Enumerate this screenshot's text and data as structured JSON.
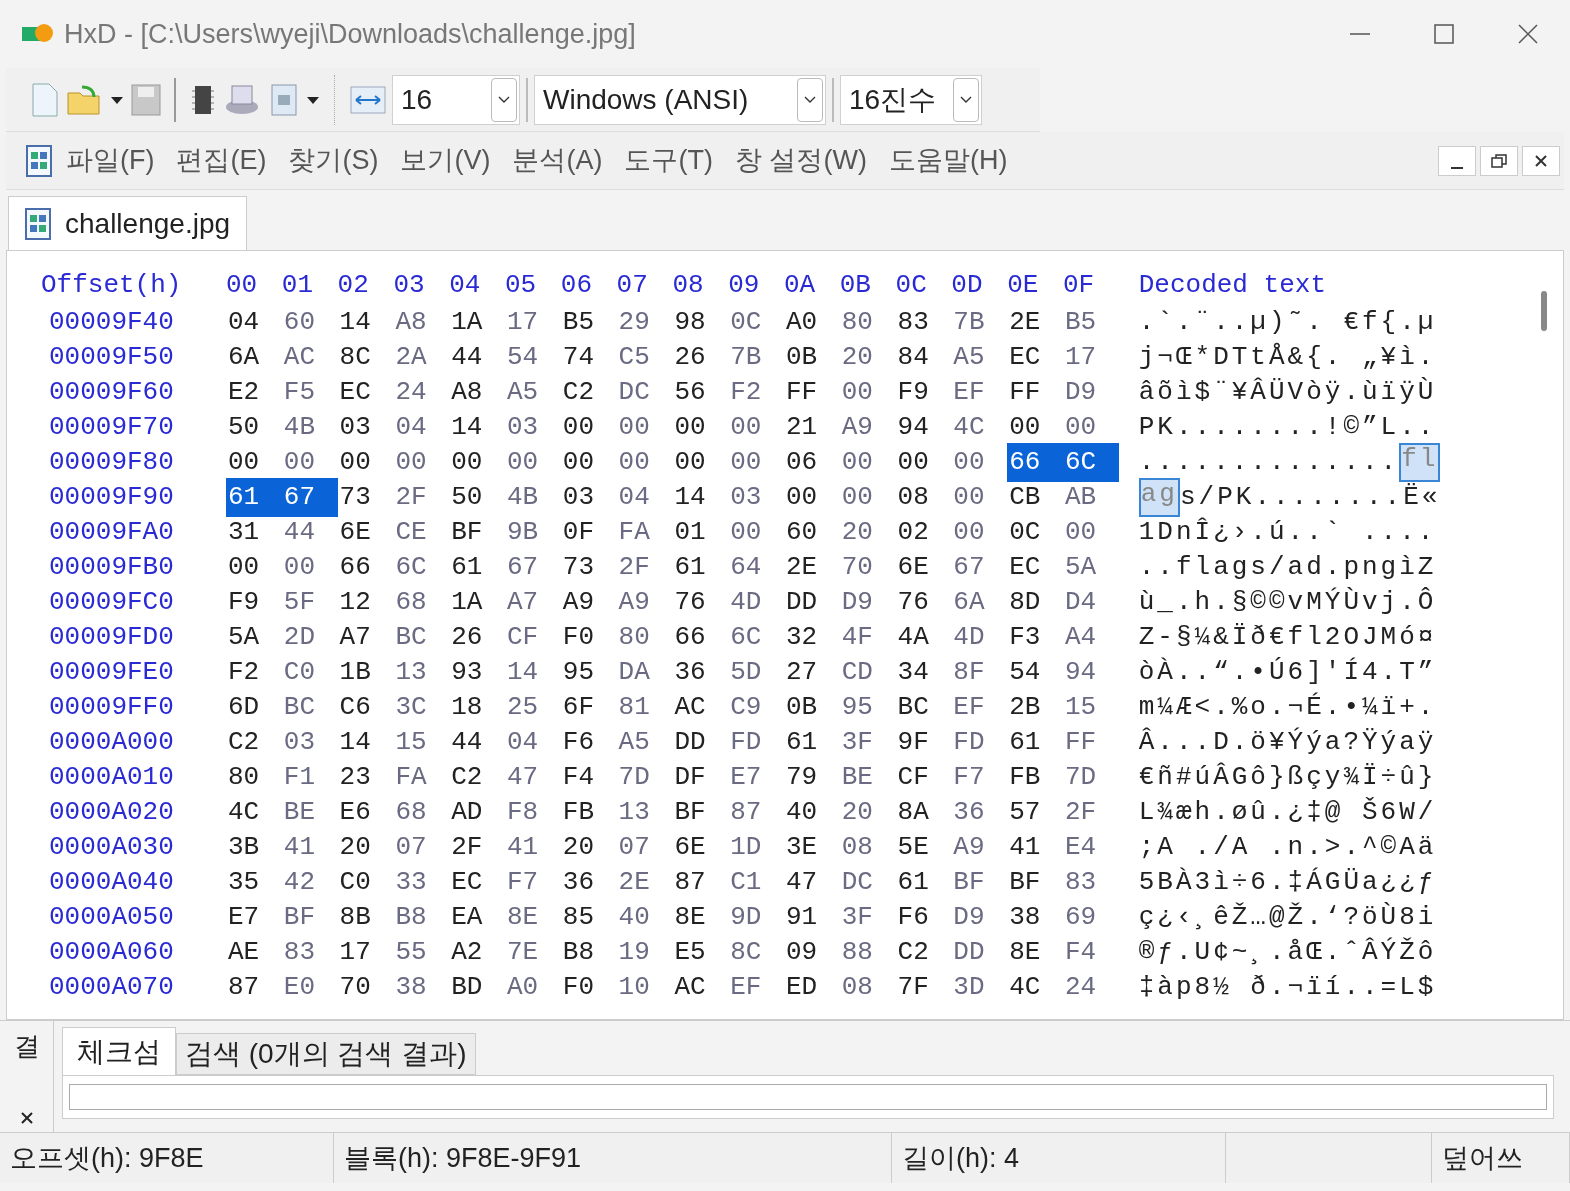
{
  "window": {
    "title": "HxD - [C:\\Users\\wyeji\\Downloads\\challenge.jpg]"
  },
  "toolbar": {
    "bytes_per_row": "16",
    "charset": "Windows (ANSI)",
    "base": "16진수"
  },
  "menu": [
    "파일(F)",
    "편집(E)",
    "찾기(S)",
    "보기(V)",
    "분석(A)",
    "도구(T)",
    "창 설정(W)",
    "도움말(H)"
  ],
  "document_tab": {
    "label": "challenge.jpg"
  },
  "hex": {
    "offset_header": "Offset(h)",
    "columns": [
      "00",
      "01",
      "02",
      "03",
      "04",
      "05",
      "06",
      "07",
      "08",
      "09",
      "0A",
      "0B",
      "0C",
      "0D",
      "0E",
      "0F"
    ],
    "decoded_header": "Decoded text",
    "rows": [
      {
        "offset": "00009F40",
        "bytes": [
          {
            "v": "04",
            "selected": false
          },
          {
            "v": "60",
            "selected": false
          },
          {
            "v": "14",
            "selected": false
          },
          {
            "v": "A8",
            "selected": false
          },
          {
            "v": "1A",
            "selected": false
          },
          {
            "v": "17",
            "selected": false
          },
          {
            "v": "B5",
            "selected": false
          },
          {
            "v": "29",
            "selected": false
          },
          {
            "v": "98",
            "selected": false
          },
          {
            "v": "0C",
            "selected": false
          },
          {
            "v": "A0",
            "selected": false
          },
          {
            "v": "80",
            "selected": false
          },
          {
            "v": "83",
            "selected": false
          },
          {
            "v": "7B",
            "selected": false
          },
          {
            "v": "2E",
            "selected": false
          },
          {
            "v": "B5",
            "selected": false
          }
        ],
        "decoded": [
          {
            "text": ".`.¨..µ)˜. €f{.µ",
            "selected": false
          }
        ]
      },
      {
        "offset": "00009F50",
        "bytes": [
          {
            "v": "6A",
            "selected": false
          },
          {
            "v": "AC",
            "selected": false
          },
          {
            "v": "8C",
            "selected": false
          },
          {
            "v": "2A",
            "selected": false
          },
          {
            "v": "44",
            "selected": false
          },
          {
            "v": "54",
            "selected": false
          },
          {
            "v": "74",
            "selected": false
          },
          {
            "v": "C5",
            "selected": false
          },
          {
            "v": "26",
            "selected": false
          },
          {
            "v": "7B",
            "selected": false
          },
          {
            "v": "0B",
            "selected": false
          },
          {
            "v": "20",
            "selected": false
          },
          {
            "v": "84",
            "selected": false
          },
          {
            "v": "A5",
            "selected": false
          },
          {
            "v": "EC",
            "selected": false
          },
          {
            "v": "17",
            "selected": false
          }
        ],
        "decoded": [
          {
            "text": "j¬Œ*DTtÅ&{. „¥ì.",
            "selected": false
          }
        ]
      },
      {
        "offset": "00009F60",
        "bytes": [
          {
            "v": "E2",
            "selected": false
          },
          {
            "v": "F5",
            "selected": false
          },
          {
            "v": "EC",
            "selected": false
          },
          {
            "v": "24",
            "selected": false
          },
          {
            "v": "A8",
            "selected": false
          },
          {
            "v": "A5",
            "selected": false
          },
          {
            "v": "C2",
            "selected": false
          },
          {
            "v": "DC",
            "selected": false
          },
          {
            "v": "56",
            "selected": false
          },
          {
            "v": "F2",
            "selected": false
          },
          {
            "v": "FF",
            "selected": false
          },
          {
            "v": "00",
            "selected": false
          },
          {
            "v": "F9",
            "selected": false
          },
          {
            "v": "EF",
            "selected": false
          },
          {
            "v": "FF",
            "selected": false
          },
          {
            "v": "D9",
            "selected": false
          }
        ],
        "decoded": [
          {
            "text": "âõì$¨¥ÂÜVòÿ.ùïÿÙ",
            "selected": false
          }
        ]
      },
      {
        "offset": "00009F70",
        "bytes": [
          {
            "v": "50",
            "selected": false
          },
          {
            "v": "4B",
            "selected": false
          },
          {
            "v": "03",
            "selected": false
          },
          {
            "v": "04",
            "selected": false
          },
          {
            "v": "14",
            "selected": false
          },
          {
            "v": "03",
            "selected": false
          },
          {
            "v": "00",
            "selected": false
          },
          {
            "v": "00",
            "selected": false
          },
          {
            "v": "00",
            "selected": false
          },
          {
            "v": "00",
            "selected": false
          },
          {
            "v": "21",
            "selected": false
          },
          {
            "v": "A9",
            "selected": false
          },
          {
            "v": "94",
            "selected": false
          },
          {
            "v": "4C",
            "selected": false
          },
          {
            "v": "00",
            "selected": false
          },
          {
            "v": "00",
            "selected": false
          }
        ],
        "decoded": [
          {
            "text": "PK........!©”L..",
            "selected": false
          }
        ]
      },
      {
        "offset": "00009F80",
        "bytes": [
          {
            "v": "00",
            "selected": false
          },
          {
            "v": "00",
            "selected": false
          },
          {
            "v": "00",
            "selected": false
          },
          {
            "v": "00",
            "selected": false
          },
          {
            "v": "00",
            "selected": false
          },
          {
            "v": "00",
            "selected": false
          },
          {
            "v": "00",
            "selected": false
          },
          {
            "v": "00",
            "selected": false
          },
          {
            "v": "00",
            "selected": false
          },
          {
            "v": "00",
            "selected": false
          },
          {
            "v": "06",
            "selected": false
          },
          {
            "v": "00",
            "selected": false
          },
          {
            "v": "00",
            "selected": false
          },
          {
            "v": "00",
            "selected": false
          },
          {
            "v": "66",
            "selected": true
          },
          {
            "v": "6C",
            "selected": true
          }
        ],
        "decoded": [
          {
            "text": "..............",
            "selected": false
          },
          {
            "text": "fl",
            "selected": true
          }
        ]
      },
      {
        "offset": "00009F90",
        "bytes": [
          {
            "v": "61",
            "selected": true
          },
          {
            "v": "67",
            "selected": true
          },
          {
            "v": "73",
            "selected": false
          },
          {
            "v": "2F",
            "selected": false
          },
          {
            "v": "50",
            "selected": false
          },
          {
            "v": "4B",
            "selected": false
          },
          {
            "v": "03",
            "selected": false
          },
          {
            "v": "04",
            "selected": false
          },
          {
            "v": "14",
            "selected": false
          },
          {
            "v": "03",
            "selected": false
          },
          {
            "v": "00",
            "selected": false
          },
          {
            "v": "00",
            "selected": false
          },
          {
            "v": "08",
            "selected": false
          },
          {
            "v": "00",
            "selected": false
          },
          {
            "v": "CB",
            "selected": false
          },
          {
            "v": "AB",
            "selected": false
          }
        ],
        "decoded": [
          {
            "text": "ag",
            "selected": true
          },
          {
            "text": "s/PK........Ë«",
            "selected": false
          }
        ]
      },
      {
        "offset": "00009FA0",
        "bytes": [
          {
            "v": "31",
            "selected": false
          },
          {
            "v": "44",
            "selected": false
          },
          {
            "v": "6E",
            "selected": false
          },
          {
            "v": "CE",
            "selected": false
          },
          {
            "v": "BF",
            "selected": false
          },
          {
            "v": "9B",
            "selected": false
          },
          {
            "v": "0F",
            "selected": false
          },
          {
            "v": "FA",
            "selected": false
          },
          {
            "v": "01",
            "selected": false
          },
          {
            "v": "00",
            "selected": false
          },
          {
            "v": "60",
            "selected": false
          },
          {
            "v": "20",
            "selected": false
          },
          {
            "v": "02",
            "selected": false
          },
          {
            "v": "00",
            "selected": false
          },
          {
            "v": "0C",
            "selected": false
          },
          {
            "v": "00",
            "selected": false
          }
        ],
        "decoded": [
          {
            "text": "1DnÎ¿›.ú..` ....",
            "selected": false
          }
        ]
      },
      {
        "offset": "00009FB0",
        "bytes": [
          {
            "v": "00",
            "selected": false
          },
          {
            "v": "00",
            "selected": false
          },
          {
            "v": "66",
            "selected": false
          },
          {
            "v": "6C",
            "selected": false
          },
          {
            "v": "61",
            "selected": false
          },
          {
            "v": "67",
            "selected": false
          },
          {
            "v": "73",
            "selected": false
          },
          {
            "v": "2F",
            "selected": false
          },
          {
            "v": "61",
            "selected": false
          },
          {
            "v": "64",
            "selected": false
          },
          {
            "v": "2E",
            "selected": false
          },
          {
            "v": "70",
            "selected": false
          },
          {
            "v": "6E",
            "selected": false
          },
          {
            "v": "67",
            "selected": false
          },
          {
            "v": "EC",
            "selected": false
          },
          {
            "v": "5A",
            "selected": false
          }
        ],
        "decoded": [
          {
            "text": "..flags/ad.pngìZ",
            "selected": false
          }
        ]
      },
      {
        "offset": "00009FC0",
        "bytes": [
          {
            "v": "F9",
            "selected": false
          },
          {
            "v": "5F",
            "selected": false
          },
          {
            "v": "12",
            "selected": false
          },
          {
            "v": "68",
            "selected": false
          },
          {
            "v": "1A",
            "selected": false
          },
          {
            "v": "A7",
            "selected": false
          },
          {
            "v": "A9",
            "selected": false
          },
          {
            "v": "A9",
            "selected": false
          },
          {
            "v": "76",
            "selected": false
          },
          {
            "v": "4D",
            "selected": false
          },
          {
            "v": "DD",
            "selected": false
          },
          {
            "v": "D9",
            "selected": false
          },
          {
            "v": "76",
            "selected": false
          },
          {
            "v": "6A",
            "selected": false
          },
          {
            "v": "8D",
            "selected": false
          },
          {
            "v": "D4",
            "selected": false
          }
        ],
        "decoded": [
          {
            "text": "ù_.h.§©©vMÝÙvj.Ô",
            "selected": false
          }
        ]
      },
      {
        "offset": "00009FD0",
        "bytes": [
          {
            "v": "5A",
            "selected": false
          },
          {
            "v": "2D",
            "selected": false
          },
          {
            "v": "A7",
            "selected": false
          },
          {
            "v": "BC",
            "selected": false
          },
          {
            "v": "26",
            "selected": false
          },
          {
            "v": "CF",
            "selected": false
          },
          {
            "v": "F0",
            "selected": false
          },
          {
            "v": "80",
            "selected": false
          },
          {
            "v": "66",
            "selected": false
          },
          {
            "v": "6C",
            "selected": false
          },
          {
            "v": "32",
            "selected": false
          },
          {
            "v": "4F",
            "selected": false
          },
          {
            "v": "4A",
            "selected": false
          },
          {
            "v": "4D",
            "selected": false
          },
          {
            "v": "F3",
            "selected": false
          },
          {
            "v": "A4",
            "selected": false
          }
        ],
        "decoded": [
          {
            "text": "Z-§¼&Ïð€fl2OJMó¤",
            "selected": false
          }
        ]
      },
      {
        "offset": "00009FE0",
        "bytes": [
          {
            "v": "F2",
            "selected": false
          },
          {
            "v": "C0",
            "selected": false
          },
          {
            "v": "1B",
            "selected": false
          },
          {
            "v": "13",
            "selected": false
          },
          {
            "v": "93",
            "selected": false
          },
          {
            "v": "14",
            "selected": false
          },
          {
            "v": "95",
            "selected": false
          },
          {
            "v": "DA",
            "selected": false
          },
          {
            "v": "36",
            "selected": false
          },
          {
            "v": "5D",
            "selected": false
          },
          {
            "v": "27",
            "selected": false
          },
          {
            "v": "CD",
            "selected": false
          },
          {
            "v": "34",
            "selected": false
          },
          {
            "v": "8F",
            "selected": false
          },
          {
            "v": "54",
            "selected": false
          },
          {
            "v": "94",
            "selected": false
          }
        ],
        "decoded": [
          {
            "text": "òÀ..“.•Ú6]'Í4.T”",
            "selected": false
          }
        ]
      },
      {
        "offset": "00009FF0",
        "bytes": [
          {
            "v": "6D",
            "selected": false
          },
          {
            "v": "BC",
            "selected": false
          },
          {
            "v": "C6",
            "selected": false
          },
          {
            "v": "3C",
            "selected": false
          },
          {
            "v": "18",
            "selected": false
          },
          {
            "v": "25",
            "selected": false
          },
          {
            "v": "6F",
            "selected": false
          },
          {
            "v": "81",
            "selected": false
          },
          {
            "v": "AC",
            "selected": false
          },
          {
            "v": "C9",
            "selected": false
          },
          {
            "v": "0B",
            "selected": false
          },
          {
            "v": "95",
            "selected": false
          },
          {
            "v": "BC",
            "selected": false
          },
          {
            "v": "EF",
            "selected": false
          },
          {
            "v": "2B",
            "selected": false
          },
          {
            "v": "15",
            "selected": false
          }
        ],
        "decoded": [
          {
            "text": "m¼Æ<.%o.¬É.•¼ï+.",
            "selected": false
          }
        ]
      },
      {
        "offset": "0000A000",
        "bytes": [
          {
            "v": "C2",
            "selected": false
          },
          {
            "v": "03",
            "selected": false
          },
          {
            "v": "14",
            "selected": false
          },
          {
            "v": "15",
            "selected": false
          },
          {
            "v": "44",
            "selected": false
          },
          {
            "v": "04",
            "selected": false
          },
          {
            "v": "F6",
            "selected": false
          },
          {
            "v": "A5",
            "selected": false
          },
          {
            "v": "DD",
            "selected": false
          },
          {
            "v": "FD",
            "selected": false
          },
          {
            "v": "61",
            "selected": false
          },
          {
            "v": "3F",
            "selected": false
          },
          {
            "v": "9F",
            "selected": false
          },
          {
            "v": "FD",
            "selected": false
          },
          {
            "v": "61",
            "selected": false
          },
          {
            "v": "FF",
            "selected": false
          }
        ],
        "decoded": [
          {
            "text": "Â...D.ö¥Ýýa?Ÿýaÿ",
            "selected": false
          }
        ]
      },
      {
        "offset": "0000A010",
        "bytes": [
          {
            "v": "80",
            "selected": false
          },
          {
            "v": "F1",
            "selected": false
          },
          {
            "v": "23",
            "selected": false
          },
          {
            "v": "FA",
            "selected": false
          },
          {
            "v": "C2",
            "selected": false
          },
          {
            "v": "47",
            "selected": false
          },
          {
            "v": "F4",
            "selected": false
          },
          {
            "v": "7D",
            "selected": false
          },
          {
            "v": "DF",
            "selected": false
          },
          {
            "v": "E7",
            "selected": false
          },
          {
            "v": "79",
            "selected": false
          },
          {
            "v": "BE",
            "selected": false
          },
          {
            "v": "CF",
            "selected": false
          },
          {
            "v": "F7",
            "selected": false
          },
          {
            "v": "FB",
            "selected": false
          },
          {
            "v": "7D",
            "selected": false
          }
        ],
        "decoded": [
          {
            "text": "€ñ#úÂGô}ßçy¾Ï÷û}",
            "selected": false
          }
        ]
      },
      {
        "offset": "0000A020",
        "bytes": [
          {
            "v": "4C",
            "selected": false
          },
          {
            "v": "BE",
            "selected": false
          },
          {
            "v": "E6",
            "selected": false
          },
          {
            "v": "68",
            "selected": false
          },
          {
            "v": "AD",
            "selected": false
          },
          {
            "v": "F8",
            "selected": false
          },
          {
            "v": "FB",
            "selected": false
          },
          {
            "v": "13",
            "selected": false
          },
          {
            "v": "BF",
            "selected": false
          },
          {
            "v": "87",
            "selected": false
          },
          {
            "v": "40",
            "selected": false
          },
          {
            "v": "20",
            "selected": false
          },
          {
            "v": "8A",
            "selected": false
          },
          {
            "v": "36",
            "selected": false
          },
          {
            "v": "57",
            "selected": false
          },
          {
            "v": "2F",
            "selected": false
          }
        ],
        "decoded": [
          {
            "text": "L¾æh.øû.¿‡@ Š6W/",
            "selected": false
          }
        ]
      },
      {
        "offset": "0000A030",
        "bytes": [
          {
            "v": "3B",
            "selected": false
          },
          {
            "v": "41",
            "selected": false
          },
          {
            "v": "20",
            "selected": false
          },
          {
            "v": "07",
            "selected": false
          },
          {
            "v": "2F",
            "selected": false
          },
          {
            "v": "41",
            "selected": false
          },
          {
            "v": "20",
            "selected": false
          },
          {
            "v": "07",
            "selected": false
          },
          {
            "v": "6E",
            "selected": false
          },
          {
            "v": "1D",
            "selected": false
          },
          {
            "v": "3E",
            "selected": false
          },
          {
            "v": "08",
            "selected": false
          },
          {
            "v": "5E",
            "selected": false
          },
          {
            "v": "A9",
            "selected": false
          },
          {
            "v": "41",
            "selected": false
          },
          {
            "v": "E4",
            "selected": false
          }
        ],
        "decoded": [
          {
            "text": ";A ./A .n.>.^©Aä",
            "selected": false
          }
        ]
      },
      {
        "offset": "0000A040",
        "bytes": [
          {
            "v": "35",
            "selected": false
          },
          {
            "v": "42",
            "selected": false
          },
          {
            "v": "C0",
            "selected": false
          },
          {
            "v": "33",
            "selected": false
          },
          {
            "v": "EC",
            "selected": false
          },
          {
            "v": "F7",
            "selected": false
          },
          {
            "v": "36",
            "selected": false
          },
          {
            "v": "2E",
            "selected": false
          },
          {
            "v": "87",
            "selected": false
          },
          {
            "v": "C1",
            "selected": false
          },
          {
            "v": "47",
            "selected": false
          },
          {
            "v": "DC",
            "selected": false
          },
          {
            "v": "61",
            "selected": false
          },
          {
            "v": "BF",
            "selected": false
          },
          {
            "v": "BF",
            "selected": false
          },
          {
            "v": "83",
            "selected": false
          }
        ],
        "decoded": [
          {
            "text": "5BÀ3ì÷6.‡ÁGÜa¿¿ƒ",
            "selected": false
          }
        ]
      },
      {
        "offset": "0000A050",
        "bytes": [
          {
            "v": "E7",
            "selected": false
          },
          {
            "v": "BF",
            "selected": false
          },
          {
            "v": "8B",
            "selected": false
          },
          {
            "v": "B8",
            "selected": false
          },
          {
            "v": "EA",
            "selected": false
          },
          {
            "v": "8E",
            "selected": false
          },
          {
            "v": "85",
            "selected": false
          },
          {
            "v": "40",
            "selected": false
          },
          {
            "v": "8E",
            "selected": false
          },
          {
            "v": "9D",
            "selected": false
          },
          {
            "v": "91",
            "selected": false
          },
          {
            "v": "3F",
            "selected": false
          },
          {
            "v": "F6",
            "selected": false
          },
          {
            "v": "D9",
            "selected": false
          },
          {
            "v": "38",
            "selected": false
          },
          {
            "v": "69",
            "selected": false
          }
        ],
        "decoded": [
          {
            "text": "ç¿‹¸êŽ…@Ž.‘?öÙ8i",
            "selected": false
          }
        ]
      },
      {
        "offset": "0000A060",
        "bytes": [
          {
            "v": "AE",
            "selected": false
          },
          {
            "v": "83",
            "selected": false
          },
          {
            "v": "17",
            "selected": false
          },
          {
            "v": "55",
            "selected": false
          },
          {
            "v": "A2",
            "selected": false
          },
          {
            "v": "7E",
            "selected": false
          },
          {
            "v": "B8",
            "selected": false
          },
          {
            "v": "19",
            "selected": false
          },
          {
            "v": "E5",
            "selected": false
          },
          {
            "v": "8C",
            "selected": false
          },
          {
            "v": "09",
            "selected": false
          },
          {
            "v": "88",
            "selected": false
          },
          {
            "v": "C2",
            "selected": false
          },
          {
            "v": "DD",
            "selected": false
          },
          {
            "v": "8E",
            "selected": false
          },
          {
            "v": "F4",
            "selected": false
          }
        ],
        "decoded": [
          {
            "text": "®ƒ.U¢~¸.åŒ.ˆÂÝŽô",
            "selected": false
          }
        ]
      },
      {
        "offset": "0000A070",
        "bytes": [
          {
            "v": "87",
            "selected": false
          },
          {
            "v": "E0",
            "selected": false
          },
          {
            "v": "70",
            "selected": false
          },
          {
            "v": "38",
            "selected": false
          },
          {
            "v": "BD",
            "selected": false
          },
          {
            "v": "A0",
            "selected": false
          },
          {
            "v": "F0",
            "selected": false
          },
          {
            "v": "10",
            "selected": false
          },
          {
            "v": "AC",
            "selected": false
          },
          {
            "v": "EF",
            "selected": false
          },
          {
            "v": "ED",
            "selected": false
          },
          {
            "v": "08",
            "selected": false
          },
          {
            "v": "7F",
            "selected": false
          },
          {
            "v": "3D",
            "selected": false
          },
          {
            "v": "4C",
            "selected": false
          },
          {
            "v": "24",
            "selected": false
          }
        ],
        "decoded": [
          {
            "text": "‡àp8½ ð.¬ïí..=L$",
            "selected": false
          }
        ]
      }
    ]
  },
  "bottom_panel": {
    "side_label": "결",
    "tabs": [
      {
        "label": "체크섬",
        "selected": true
      },
      {
        "label": "검색 (0개의 검색 결과)",
        "selected": false
      }
    ]
  },
  "status_bar": [
    "오프셋(h): 9F8E",
    "블록(h): 9F8E-9F91",
    "길이(h): 4",
    "덮어쓰"
  ]
}
